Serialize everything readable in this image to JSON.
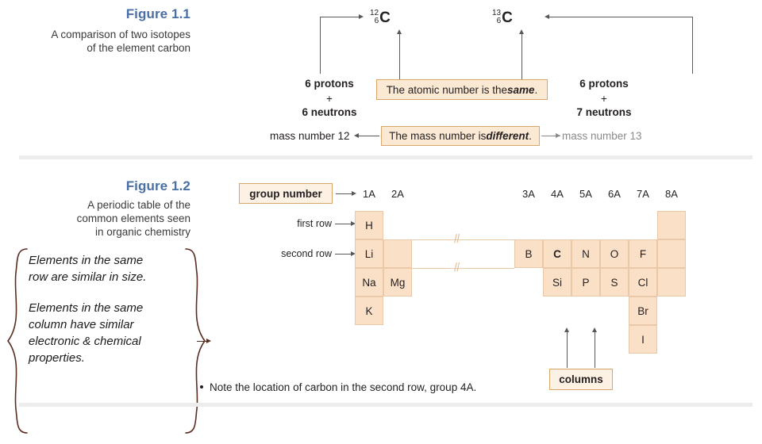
{
  "figure_1_1": {
    "title": "Figure 1.1",
    "subtitle_line1": "A comparison of two isotopes",
    "subtitle_line2": "of the element carbon",
    "left_isotope": {
      "mass_number": "12",
      "atomic_number": "6",
      "symbol": "C"
    },
    "right_isotope": {
      "mass_number": "13",
      "atomic_number": "6",
      "symbol": "C"
    },
    "left_protons": "6 protons",
    "left_plus": "+",
    "left_neutrons": "6 neutrons",
    "left_mass_label": "mass number 12",
    "right_protons": "6 protons",
    "right_plus": "+",
    "right_neutrons": "7 neutrons",
    "right_mass_label": "mass number 13",
    "callout_atomic_prefix": "The atomic number is the ",
    "callout_atomic_emph": "same",
    "callout_atomic_suffix": ".",
    "callout_mass_prefix": "The mass number is ",
    "callout_mass_emph": "different",
    "callout_mass_suffix": "."
  },
  "figure_1_2": {
    "title": "Figure 1.2",
    "subtitle_line1": "A periodic table of the",
    "subtitle_line2": "common elements seen",
    "subtitle_line3": "in organic chemistry",
    "group_number_label": "group number",
    "first_row_label": "first row",
    "second_row_label": "second row",
    "columns_label": "columns",
    "note": "Note the location of carbon in the second row, group 4A.",
    "group_headers": [
      "1A",
      "2A",
      "3A",
      "4A",
      "5A",
      "6A",
      "7A",
      "8A"
    ],
    "cells": [
      {
        "label": "H",
        "col": 1,
        "row": 1,
        "bold": false
      },
      {
        "label": "",
        "col": 8,
        "row": 1,
        "bold": false
      },
      {
        "label": "Li",
        "col": 1,
        "row": 2,
        "bold": false
      },
      {
        "label": "",
        "col": 2,
        "row": 2,
        "bold": false
      },
      {
        "label": "B",
        "col": 3,
        "row": 2,
        "bold": false
      },
      {
        "label": "C",
        "col": 4,
        "row": 2,
        "bold": true
      },
      {
        "label": "N",
        "col": 5,
        "row": 2,
        "bold": false
      },
      {
        "label": "O",
        "col": 6,
        "row": 2,
        "bold": false
      },
      {
        "label": "F",
        "col": 7,
        "row": 2,
        "bold": false
      },
      {
        "label": "",
        "col": 8,
        "row": 2,
        "bold": false
      },
      {
        "label": "Na",
        "col": 1,
        "row": 3,
        "bold": false
      },
      {
        "label": "Mg",
        "col": 2,
        "row": 3,
        "bold": false
      },
      {
        "label": "Si",
        "col": 4,
        "row": 3,
        "bold": false
      },
      {
        "label": "P",
        "col": 5,
        "row": 3,
        "bold": false
      },
      {
        "label": "S",
        "col": 6,
        "row": 3,
        "bold": false
      },
      {
        "label": "Cl",
        "col": 7,
        "row": 3,
        "bold": false
      },
      {
        "label": "",
        "col": 8,
        "row": 3,
        "bold": false
      },
      {
        "label": "K",
        "col": 1,
        "row": 4,
        "bold": false
      },
      {
        "label": "Br",
        "col": 7,
        "row": 4,
        "bold": false
      },
      {
        "label": "I",
        "col": 7,
        "row": 5,
        "bold": false
      }
    ]
  },
  "annotation": {
    "block1_line1": "Elements in the same",
    "block1_line2": "row are similar in size.",
    "block2_line1": "Elements in the same",
    "block2_line2": "column have similar",
    "block2_line3": "electronic & chemical",
    "block2_line4": "properties."
  },
  "colors": {
    "figure_title": "#4a6fa5",
    "callout_fill": "#fbe9d4",
    "callout_border": "#d9a76c",
    "cell_fill": "#fbe0c8",
    "cell_border": "#e9c9a8",
    "brace": "#5a2d20",
    "divider": "#ececec",
    "line": "#58595b"
  }
}
